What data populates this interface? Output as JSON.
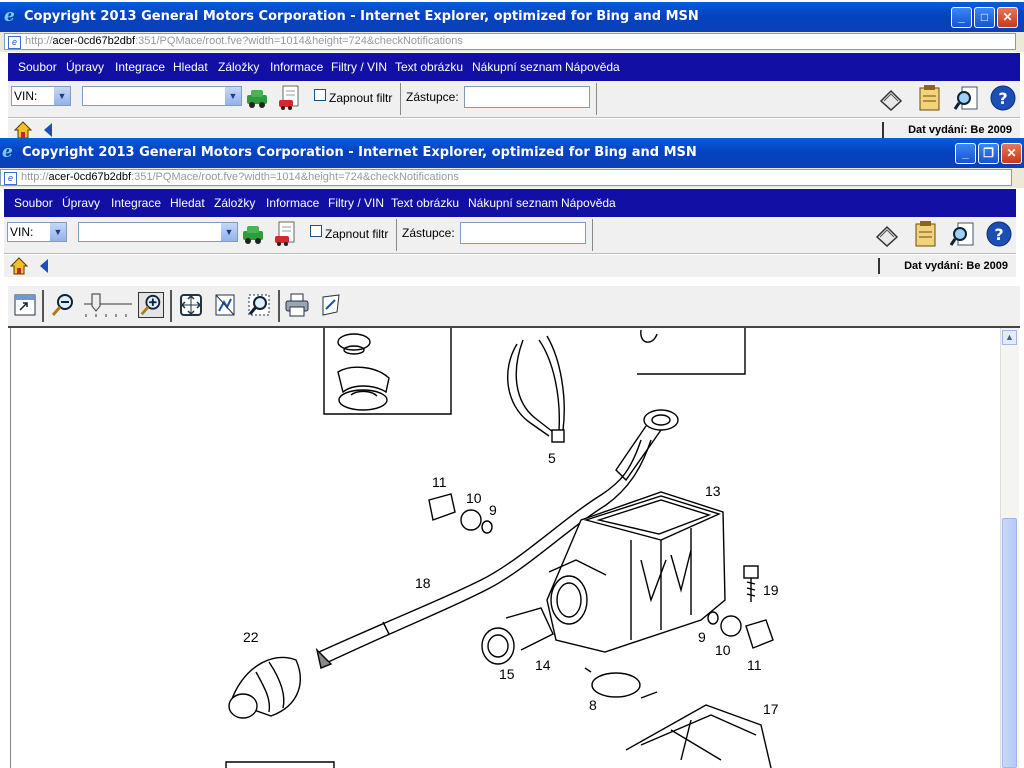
{
  "window_title": "Copyright 2013 General Motors Corporation - Internet Explorer, optimized for Bing and MSN",
  "address": {
    "host": "acer-0cd67b2dbf",
    "rest": ":351/PQMace/root.fve?width=1014&height=724&checkNotifications"
  },
  "menu": [
    "Soubor",
    "Úpravy",
    "Integrace",
    "Hledat",
    "Záložky",
    "Informace",
    "Filtry / VIN",
    "Text obrázku",
    "Nákupní seznam",
    "Nápověda"
  ],
  "toolbar": {
    "vin_label": "VIN:",
    "filter_label": "Zapnout filtr",
    "rep_label": "Zástupce:"
  },
  "nav": {
    "date_label": "Dat vydání: Be 2009"
  },
  "colors": {
    "menubar": "#1210a4",
    "titlebar": "#0543c1"
  },
  "diagram": {
    "labels": [
      "5",
      "11",
      "10",
      "9",
      "13",
      "18",
      "19",
      "22",
      "9",
      "10",
      "11",
      "15",
      "14",
      "8",
      "17"
    ]
  }
}
